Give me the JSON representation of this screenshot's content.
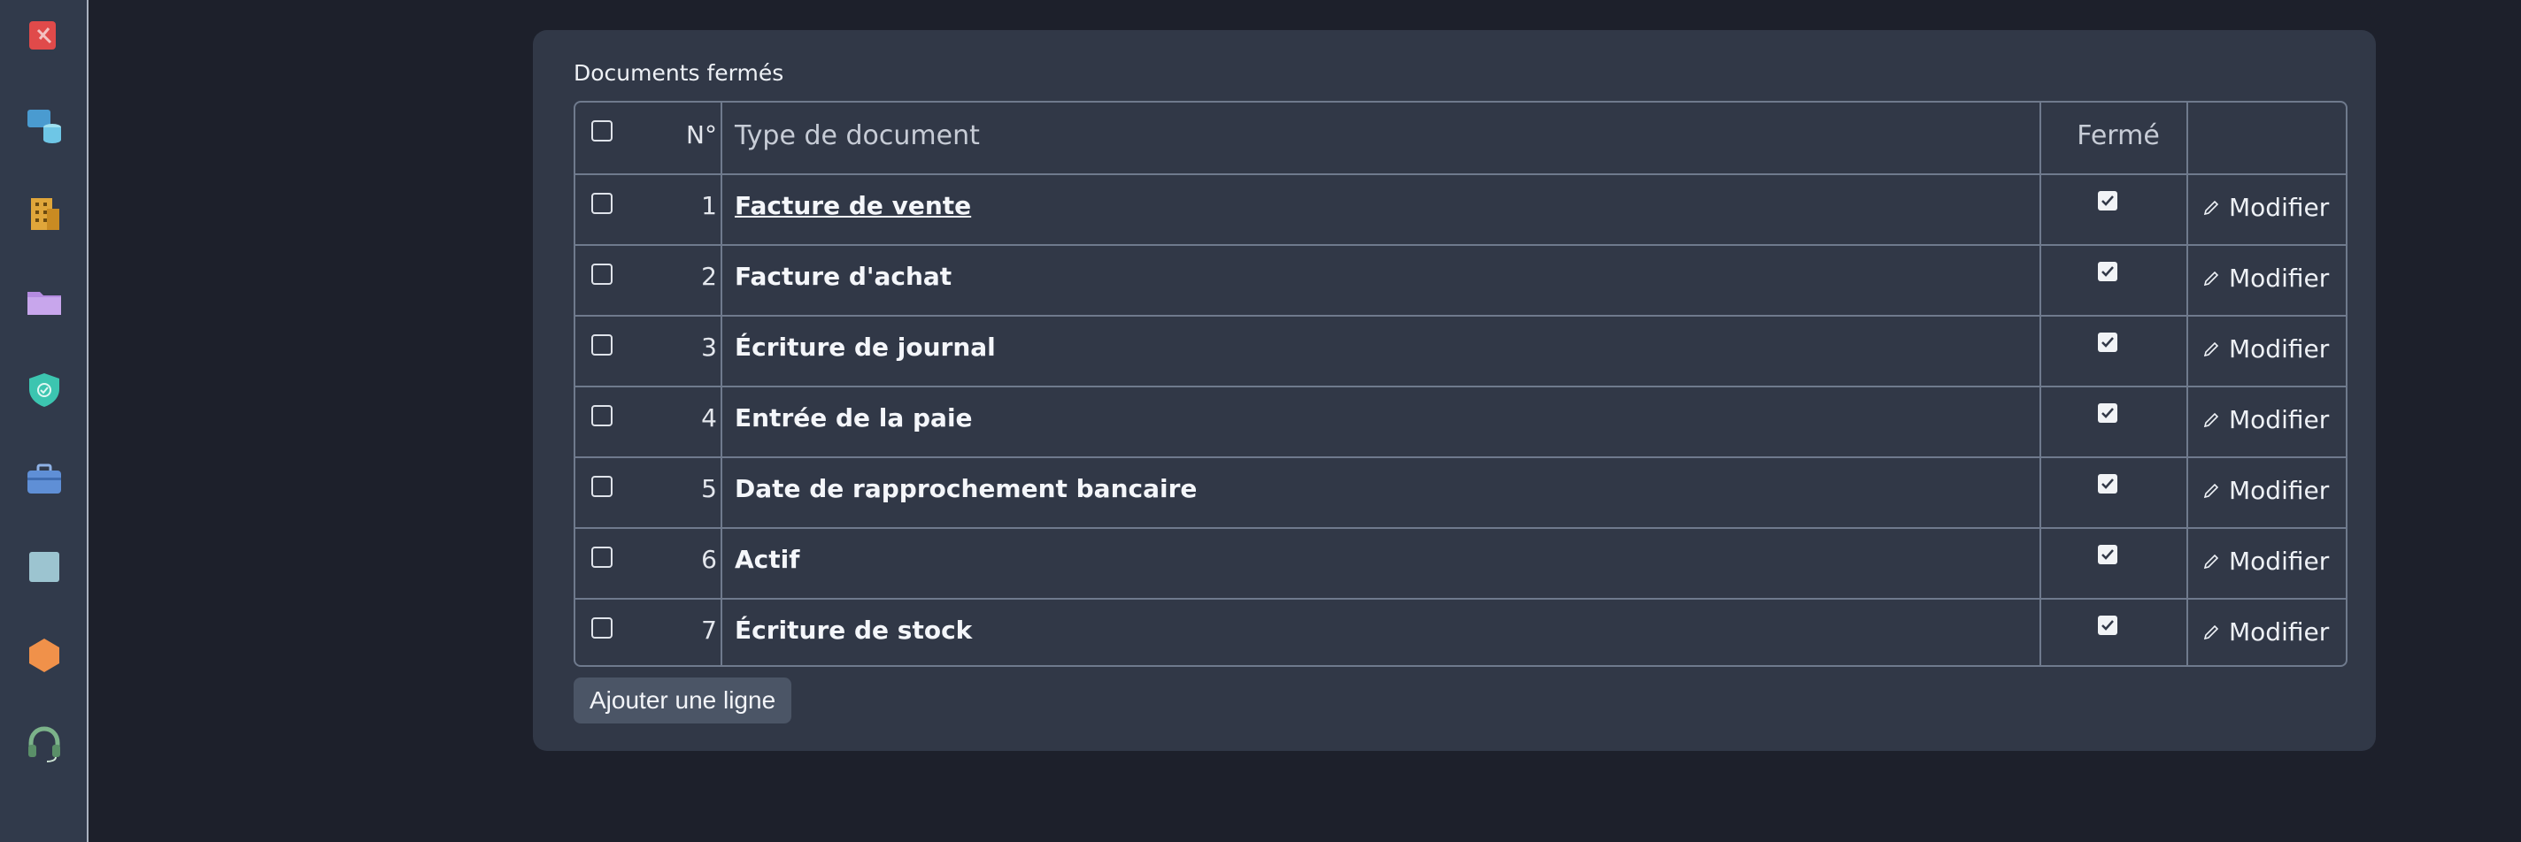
{
  "sidebar": {
    "icons": [
      {
        "name": "sales-icon",
        "color": "#e04a4a"
      },
      {
        "name": "database-icon",
        "color": "#6ec6e6"
      },
      {
        "name": "building-icon",
        "color": "#e0a63a"
      },
      {
        "name": "folder-icon",
        "color": "#b48be0"
      },
      {
        "name": "shield-icon",
        "color": "#3cc5b0"
      },
      {
        "name": "briefcase-icon",
        "color": "#5f8fd6"
      },
      {
        "name": "square-icon",
        "color": "#9cc4d0"
      },
      {
        "name": "hexagon-icon",
        "color": "#f0914a"
      },
      {
        "name": "headset-icon",
        "color": "#7cb38a"
      }
    ]
  },
  "panel": {
    "title": "Documents fermés",
    "columns": {
      "number": "N°",
      "type": "Type de document",
      "closed": "Fermé"
    },
    "rows": [
      {
        "number": "1",
        "type": "Facture de vente",
        "edit": "Modifier"
      },
      {
        "number": "2",
        "type": "Facture d'achat",
        "edit": "Modifier"
      },
      {
        "number": "3",
        "type": "Écriture de journal",
        "edit": "Modifier"
      },
      {
        "number": "4",
        "type": "Entrée de la paie",
        "edit": "Modifier"
      },
      {
        "number": "5",
        "type": "Date de rapprochement bancaire",
        "edit": "Modifier"
      },
      {
        "number": "6",
        "type": "Actif",
        "edit": "Modifier"
      },
      {
        "number": "7",
        "type": "Écriture de stock",
        "edit": "Modifier"
      }
    ],
    "add_row_label": "Ajouter une ligne"
  }
}
